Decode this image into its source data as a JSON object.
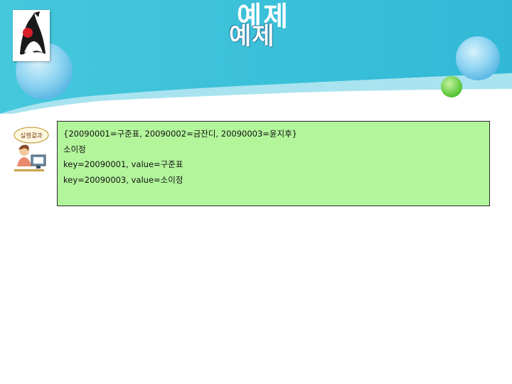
{
  "header": {
    "title": "예제"
  },
  "output": {
    "lines": [
      "{20090001=구준표, 20090002=금잔디, 20090003=윤지후}",
      "소이정",
      "key=20090001, value=구준표",
      "key=20090003, value=소이정"
    ]
  },
  "mascot": {
    "badge_text": "실행결과"
  },
  "colors": {
    "banner": "#3dc1d8",
    "output_bg": "#b3f59b",
    "bubble": "#8fd4f2",
    "green_dot": "#6cd44a"
  }
}
